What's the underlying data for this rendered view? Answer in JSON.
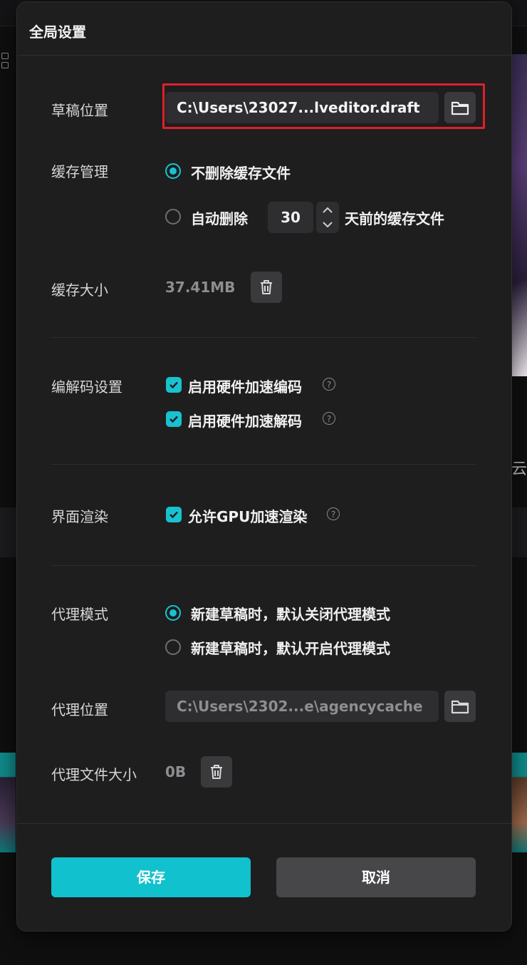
{
  "dialog": {
    "title": "全局设置",
    "draft_location": {
      "label": "草稿位置",
      "path": "C:\\Users\\23027...lveditor.draft"
    },
    "cache_management": {
      "label": "缓存管理",
      "option_keep": "不删除缓存文件",
      "option_auto_prefix": "自动删除",
      "days_value": "30",
      "option_auto_suffix": "天前的缓存文件",
      "selected": "keep"
    },
    "cache_size": {
      "label": "缓存大小",
      "value": "37.41MB"
    },
    "codec": {
      "label": "编解码设置",
      "hw_encode": "启用硬件加速编码",
      "hw_decode": "启用硬件加速解码",
      "hw_encode_checked": true,
      "hw_decode_checked": true
    },
    "render": {
      "label": "界面渲染",
      "gpu": "允许GPU加速渲染",
      "gpu_checked": true
    },
    "proxy_mode": {
      "label": "代理模式",
      "option_off": "新建草稿时，默认关闭代理模式",
      "option_on": "新建草稿时，默认开启代理模式",
      "selected": "off"
    },
    "proxy_location": {
      "label": "代理位置",
      "path": "C:\\Users\\2302...e\\agencycache"
    },
    "proxy_size": {
      "label": "代理文件大小",
      "value": "0B"
    },
    "buttons": {
      "save": "保存",
      "cancel": "取消"
    },
    "help_glyph": "?"
  },
  "background": {
    "right_text": "云"
  },
  "colors": {
    "accent": "#11c1cd",
    "highlight_border": "#e0202a"
  }
}
